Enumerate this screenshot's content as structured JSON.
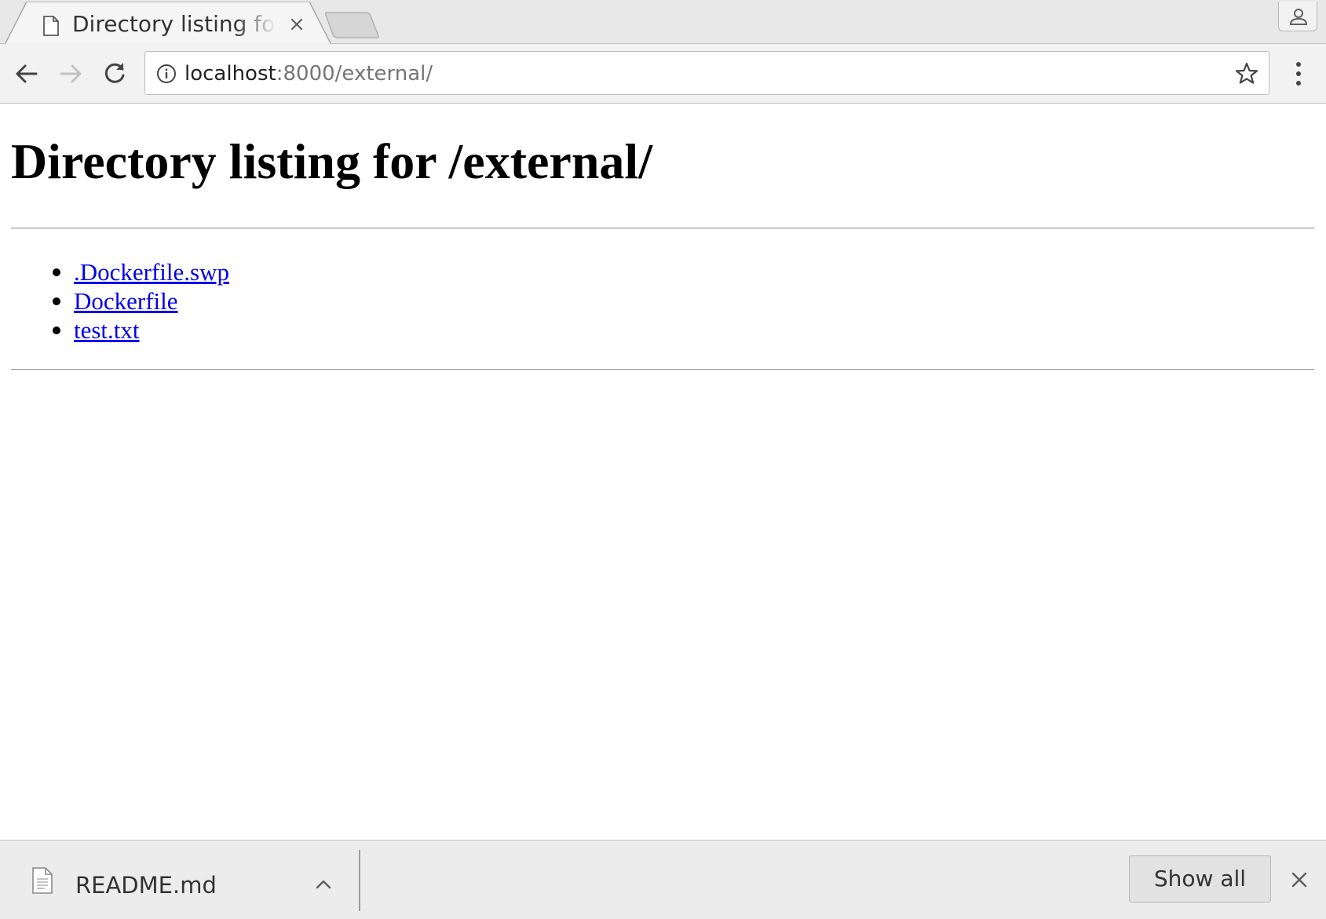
{
  "browser": {
    "tab": {
      "title": "Directory listing for /external/",
      "page_icon": "document-icon",
      "close_icon": "close-icon"
    },
    "new_tab_icon": "new-tab-icon",
    "profile_icon": "person-icon",
    "toolbar": {
      "back_icon": "arrow-left-icon",
      "forward_icon": "arrow-right-icon",
      "reload_icon": "reload-icon",
      "info_icon": "info-icon",
      "bookmark_icon": "star-outline-icon",
      "menu_icon": "vertical-dots-icon"
    },
    "address": {
      "host": "localhost",
      "rest": ":8000/external/"
    }
  },
  "page": {
    "heading": "Directory listing for /external/",
    "files": [
      {
        "name": ".Dockerfile.swp"
      },
      {
        "name": "Dockerfile"
      },
      {
        "name": "test.txt"
      }
    ],
    "link_color": "#0000ee"
  },
  "downloads": {
    "item": {
      "filename": "README.md",
      "file_icon": "document-icon",
      "chevron_icon": "chevron-up-icon"
    },
    "show_all_label": "Show all",
    "close_icon": "close-icon"
  }
}
